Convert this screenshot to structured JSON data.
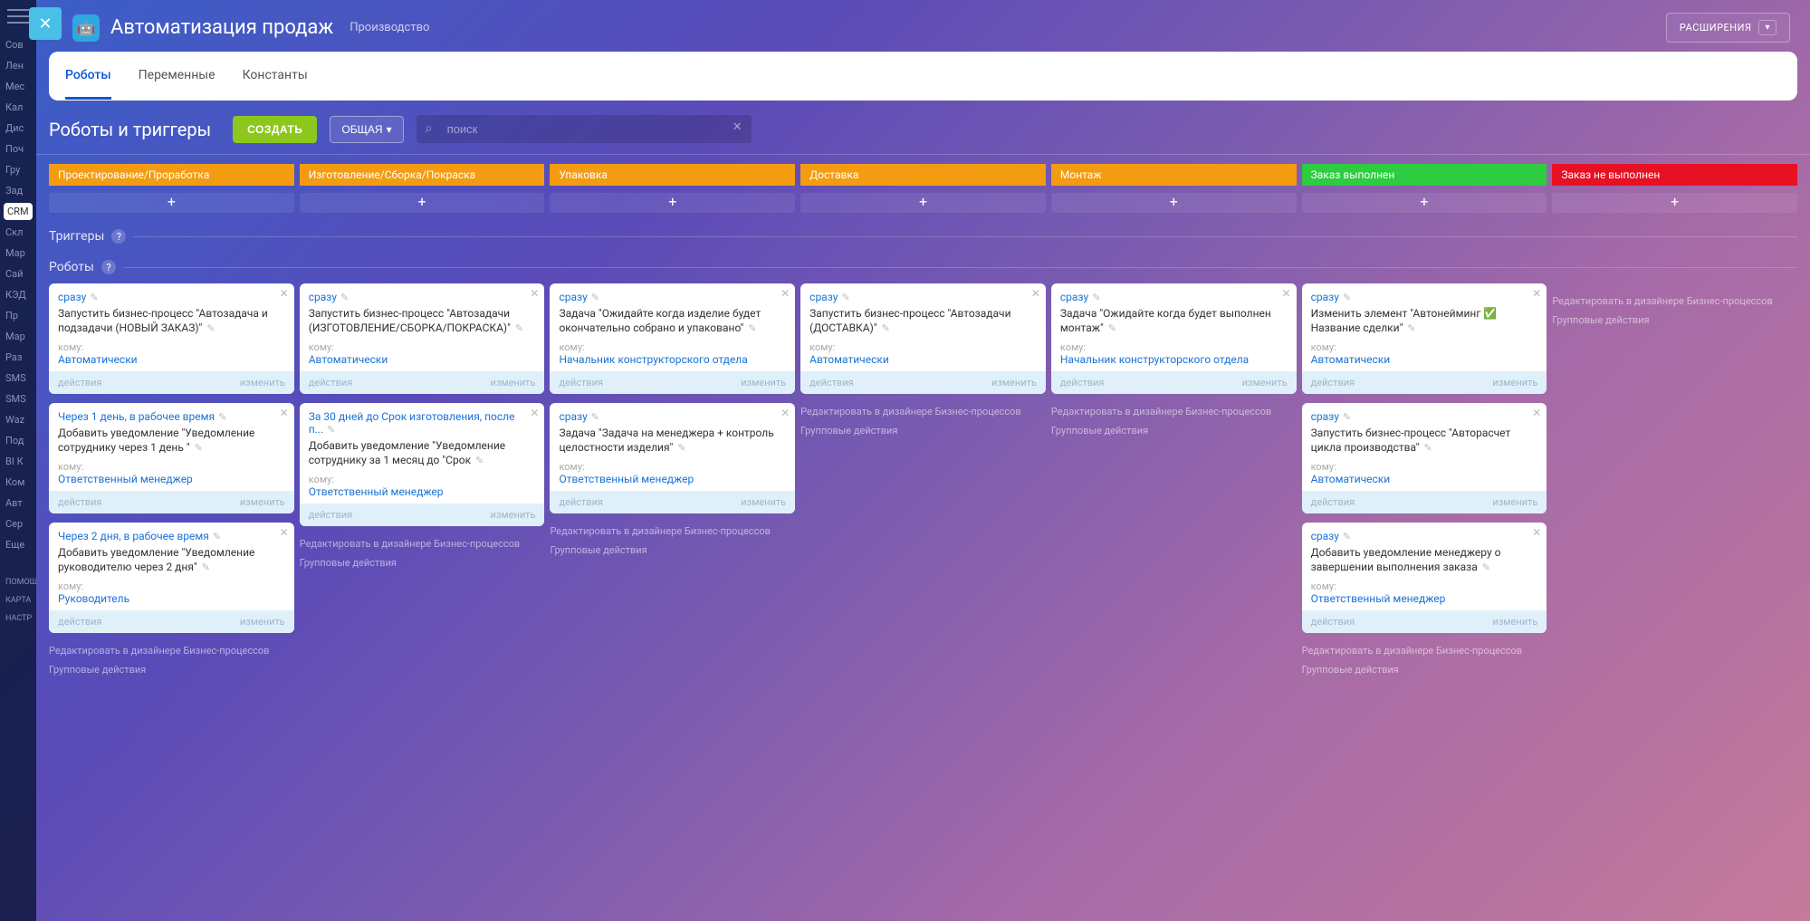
{
  "sidebar": {
    "items": [
      "Сов",
      "Лен",
      "Мес",
      "Кал",
      "Дис",
      "Поч",
      "Гру",
      "Зад",
      "CRM",
      "Скл",
      "Мар",
      "Сай",
      "КЭД",
      "Пр",
      "Мар",
      "Раз",
      "SMS",
      "SMS",
      "Waz",
      "Под",
      "BI К",
      "Ком",
      "Авт",
      "Сер",
      "Еще"
    ],
    "active_index": 8,
    "footer_items": [
      "ПОМОЩ",
      "КАРТА",
      "НАСТР"
    ]
  },
  "header": {
    "title": "Автоматизация продаж",
    "subtitle": "Производство",
    "extensions": "РАСШИРЕНИЯ"
  },
  "tabs": {
    "items": [
      "Роботы",
      "Переменные",
      "Константы"
    ],
    "active_index": 0
  },
  "controls": {
    "heading": "Роботы и триггеры",
    "create": "СОЗДАТЬ",
    "common": "ОБЩАЯ",
    "search_placeholder": "поиск"
  },
  "sections": {
    "triggers": "Триггеры",
    "robots": "Роботы"
  },
  "link_edit_bp": "Редактировать в дизайнере Бизнес-процессов",
  "link_group_actions": "Групповые действия",
  "card_labels": {
    "to_whom": "кому:",
    "actions": "действия",
    "change": "изменить"
  },
  "columns": [
    {
      "stage": "Проектирование/Проработка",
      "color": "orange",
      "cards": [
        {
          "trigger": "сразу",
          "desc": "Запустить бизнес-процесс \"Автозадача и подзадачи (НОВЫЙ ЗАКАЗ)\"",
          "assignee": "Автоматически"
        },
        {
          "trigger": "Через 1 день, в рабочее время",
          "desc": "Добавить уведомление \"Уведомление сотруднику через 1 день \"",
          "assignee": "Ответственный менеджер"
        },
        {
          "trigger": "Через 2 дня, в рабочее время",
          "desc": "Добавить уведомление \"Уведомление руководителю через 2 дня\"",
          "assignee": "Руководитель"
        }
      ],
      "show_links": true
    },
    {
      "stage": "Изготовление/Сборка/Покраска",
      "color": "orange",
      "cards": [
        {
          "trigger": "сразу",
          "desc": "Запустить бизнес-процесс \"Автозадачи (ИЗГОТОВЛЕНИЕ/СБОРКА/ПОКРАСКА)\"",
          "assignee": "Автоматически"
        },
        {
          "trigger": "За 30 дней до Срок изготовления, после п...",
          "desc": "Добавить уведомление \"Уведомление сотруднику за 1 месяц до \"Срок",
          "assignee": "Ответственный менеджер"
        }
      ],
      "show_links": true
    },
    {
      "stage": "Упаковка",
      "color": "orange",
      "cards": [
        {
          "trigger": "сразу",
          "desc": "Задача \"Ожидайте когда изделие будет окончательно собрано и упаковано\"",
          "assignee": "Начальник конструкторского отдела"
        },
        {
          "trigger": "сразу",
          "desc": "Задача \"Задача на менеджера + контроль целостности изделия\"",
          "assignee": "Ответственный менеджер"
        }
      ],
      "show_links": true
    },
    {
      "stage": "Доставка",
      "color": "orange",
      "cards": [
        {
          "trigger": "сразу",
          "desc": "Запустить бизнес-процесс \"Автозадачи (ДОСТАВКА)\"",
          "assignee": "Автоматически"
        }
      ],
      "show_links": true
    },
    {
      "stage": "Монтаж",
      "color": "orange",
      "cards": [
        {
          "trigger": "сразу",
          "desc": "Задача \"Ожидайте когда будет выполнен монтаж\"",
          "assignee": "Начальник конструкторского отдела"
        }
      ],
      "show_links": true
    },
    {
      "stage": "Заказ выполнен",
      "color": "green",
      "cards": [
        {
          "trigger": "сразу",
          "desc": "Изменить элемент \"Автонейминг ✅ Название сделки\"",
          "assignee": "Автоматически"
        },
        {
          "trigger": "сразу",
          "desc": "Запустить бизнес-процесс \"Авторасчет цикла производства\"",
          "assignee": "Автоматически"
        },
        {
          "trigger": "сразу",
          "desc": "Добавить уведомление менеджеру о завершении выполнения заказа",
          "assignee": "Ответственный менеджер"
        }
      ],
      "show_links": true
    },
    {
      "stage": "Заказ не выполнен",
      "color": "red",
      "cards": [],
      "show_links": true
    }
  ]
}
